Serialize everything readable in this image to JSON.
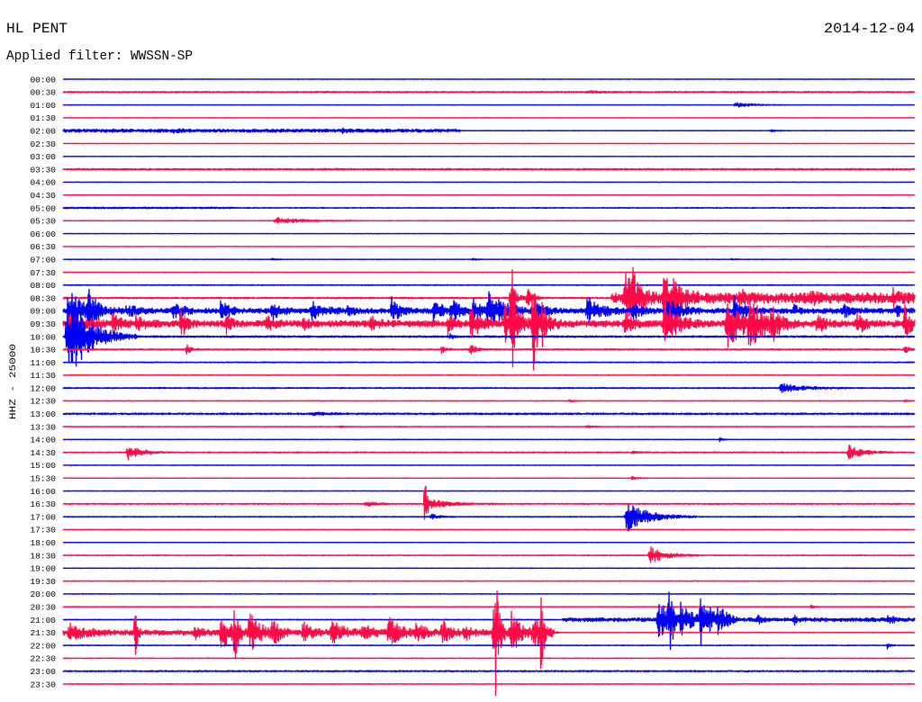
{
  "chart_data": {
    "type": "line",
    "title": "HL PENT",
    "date": "2014-12-04",
    "subtitle": "Applied filter: WWSSN-SP",
    "ylabel": "HHZ - 25000",
    "xlim_minutes": [
      0,
      30
    ],
    "grid": false,
    "colors": {
      "blue": "#0000f2",
      "red": "#ff0a46"
    },
    "rows": [
      {
        "label": "00:00",
        "color": "blue",
        "noise": 400,
        "bursts": []
      },
      {
        "label": "00:30",
        "color": "red",
        "noise": 1200,
        "bursts": [
          {
            "start": 18.4,
            "dur": 1.0,
            "amp": 2500
          }
        ]
      },
      {
        "label": "01:00",
        "color": "blue",
        "noise": 400,
        "bursts": [
          {
            "start": 23.6,
            "dur": 1.2,
            "amp": 6000
          }
        ]
      },
      {
        "label": "01:30",
        "color": "red",
        "noise": 400,
        "bursts": []
      },
      {
        "label": "02:00",
        "color": "blue",
        "noise": [
          {
            "start": 0,
            "end": 14,
            "amp": 3000
          },
          {
            "start": 14,
            "end": 30,
            "amp": 500
          }
        ],
        "bursts": [
          {
            "start": 3.8,
            "dur": 0.6,
            "amp": 4000
          },
          {
            "start": 9.8,
            "dur": 0.6,
            "amp": 4000
          },
          {
            "start": 24.9,
            "dur": 0.5,
            "amp": 2500
          }
        ]
      },
      {
        "label": "02:30",
        "color": "red",
        "noise": 400,
        "bursts": []
      },
      {
        "label": "03:00",
        "color": "blue",
        "noise": 400,
        "bursts": []
      },
      {
        "label": "03:30",
        "color": "red",
        "noise": 1500,
        "bursts": []
      },
      {
        "label": "04:00",
        "color": "blue",
        "noise": 400,
        "bursts": []
      },
      {
        "label": "04:30",
        "color": "red",
        "noise": 400,
        "bursts": []
      },
      {
        "label": "05:00",
        "color": "blue",
        "noise": [
          {
            "start": 0,
            "end": 6,
            "amp": 1500
          },
          {
            "start": 6,
            "end": 30,
            "amp": 800
          }
        ],
        "bursts": []
      },
      {
        "label": "05:30",
        "color": "red",
        "noise": 500,
        "bursts": [
          {
            "start": 7.4,
            "dur": 2.0,
            "amp": 7000
          }
        ]
      },
      {
        "label": "06:00",
        "color": "blue",
        "noise": 400,
        "bursts": []
      },
      {
        "label": "06:30",
        "color": "red",
        "noise": 400,
        "bursts": []
      },
      {
        "label": "07:00",
        "color": "blue",
        "noise": 500,
        "bursts": [
          {
            "start": 7.3,
            "dur": 0.3,
            "amp": 2500
          },
          {
            "start": 14.4,
            "dur": 0.3,
            "amp": 3000
          },
          {
            "start": 23.5,
            "dur": 0.3,
            "amp": 2000
          }
        ]
      },
      {
        "label": "07:30",
        "color": "red",
        "noise": 400,
        "bursts": []
      },
      {
        "label": "08:00",
        "color": "blue",
        "noise": 800,
        "bursts": []
      },
      {
        "label": "08:30",
        "color": "red",
        "noise": [
          {
            "start": 0,
            "end": 19.3,
            "amp": 1500
          },
          {
            "start": 19.3,
            "end": 30,
            "amp": 10000
          }
        ],
        "bursts": [
          {
            "start": 15.7,
            "dur": 0.5,
            "amp": 30000
          },
          {
            "start": 16.3,
            "dur": 0.4,
            "amp": 25000
          },
          {
            "start": 19.7,
            "dur": 0.8,
            "amp": 60000
          },
          {
            "start": 20.0,
            "dur": 0.5,
            "amp": 40000
          },
          {
            "start": 21.1,
            "dur": 0.8,
            "amp": 55000
          },
          {
            "start": 21.4,
            "dur": 0.6,
            "amp": 40000
          },
          {
            "start": 23.8,
            "dur": 0.5,
            "amp": 15000
          },
          {
            "start": 26.3,
            "dur": 0.4,
            "amp": 12000
          },
          {
            "start": 29.2,
            "dur": 0.4,
            "amp": 15000
          }
        ]
      },
      {
        "label": "09:00",
        "color": "blue",
        "noise": 5000,
        "bursts": [
          {
            "start": 0.16,
            "dur": 1.2,
            "amp": 40000
          },
          {
            "start": 0.86,
            "dur": 0.4,
            "amp": 60000
          },
          {
            "start": 2.2,
            "dur": 0.6,
            "amp": 15000
          },
          {
            "start": 3.8,
            "dur": 0.8,
            "amp": 15000
          },
          {
            "start": 5.5,
            "dur": 0.5,
            "amp": 30000
          },
          {
            "start": 7.3,
            "dur": 0.5,
            "amp": 25000
          },
          {
            "start": 8.7,
            "dur": 0.8,
            "amp": 20000
          },
          {
            "start": 10.0,
            "dur": 0.4,
            "amp": 12000
          },
          {
            "start": 11.5,
            "dur": 0.6,
            "amp": 30000
          },
          {
            "start": 13.0,
            "dur": 0.6,
            "amp": 30000
          },
          {
            "start": 13.6,
            "dur": 0.8,
            "amp": 25000
          },
          {
            "start": 14.4,
            "dur": 0.5,
            "amp": 25000
          },
          {
            "start": 14.9,
            "dur": 1.2,
            "amp": 40000
          },
          {
            "start": 16.6,
            "dur": 0.6,
            "amp": 20000
          },
          {
            "start": 18.4,
            "dur": 1.0,
            "amp": 30000
          },
          {
            "start": 20.0,
            "dur": 0.6,
            "amp": 20000
          },
          {
            "start": 21.2,
            "dur": 0.8,
            "amp": 30000
          },
          {
            "start": 23.6,
            "dur": 0.7,
            "amp": 35000
          },
          {
            "start": 25.7,
            "dur": 0.4,
            "amp": 12000
          },
          {
            "start": 27.4,
            "dur": 0.6,
            "amp": 15000
          },
          {
            "start": 29.3,
            "dur": 0.5,
            "amp": 12000
          }
        ]
      },
      {
        "label": "09:30",
        "color": "red",
        "noise": 6000,
        "bursts": [
          {
            "start": 0.16,
            "dur": 1.0,
            "amp": 25000
          },
          {
            "start": 1.7,
            "dur": 0.6,
            "amp": 20000
          },
          {
            "start": 2.5,
            "dur": 0.6,
            "amp": 20000
          },
          {
            "start": 4.1,
            "dur": 0.4,
            "amp": 35000
          },
          {
            "start": 5.7,
            "dur": 0.4,
            "amp": 20000
          },
          {
            "start": 7.1,
            "dur": 0.5,
            "amp": 20000
          },
          {
            "start": 8.4,
            "dur": 0.4,
            "amp": 15000
          },
          {
            "start": 10.8,
            "dur": 0.6,
            "amp": 15000
          },
          {
            "start": 13.5,
            "dur": 0.4,
            "amp": 25000
          },
          {
            "start": 14.3,
            "dur": 0.6,
            "amp": 45000
          },
          {
            "start": 15.5,
            "dur": 1.0,
            "amp": 55000
          },
          {
            "start": 15.8,
            "dur": 0.15,
            "amp": 230000
          },
          {
            "start": 16.5,
            "dur": 0.3,
            "amp": 160000
          },
          {
            "start": 16.8,
            "dur": 0.6,
            "amp": 40000
          },
          {
            "start": 19.7,
            "dur": 0.6,
            "amp": 25000
          },
          {
            "start": 21.1,
            "dur": 1.0,
            "amp": 45000
          },
          {
            "start": 23.3,
            "dur": 1.2,
            "amp": 60000
          },
          {
            "start": 24.1,
            "dur": 1.0,
            "amp": 50000
          },
          {
            "start": 24.9,
            "dur": 0.8,
            "amp": 30000
          },
          {
            "start": 26.5,
            "dur": 0.6,
            "amp": 20000
          },
          {
            "start": 27.9,
            "dur": 0.6,
            "amp": 25000
          },
          {
            "start": 29.6,
            "dur": 0.4,
            "amp": 45000
          }
        ]
      },
      {
        "label": "10:00",
        "color": "blue",
        "noise": 1500,
        "bursts": [
          {
            "start": 0.06,
            "dur": 1.6,
            "amp": 100000
          },
          {
            "start": 13.6,
            "dur": 0.3,
            "amp": 6000
          }
        ]
      },
      {
        "label": "10:30",
        "color": "red",
        "noise": 1200,
        "bursts": [
          {
            "start": 4.3,
            "dur": 0.3,
            "amp": 15000
          },
          {
            "start": 13.3,
            "dur": 0.3,
            "amp": 10000
          },
          {
            "start": 14.3,
            "dur": 0.4,
            "amp": 15000
          },
          {
            "start": 29.6,
            "dur": 0.3,
            "amp": 12000
          }
        ]
      },
      {
        "label": "11:00",
        "color": "blue",
        "noise": 800,
        "bursts": []
      },
      {
        "label": "11:30",
        "color": "red",
        "noise": 600,
        "bursts": []
      },
      {
        "label": "12:00",
        "color": "blue",
        "noise": 1000,
        "bursts": [
          {
            "start": 25.2,
            "dur": 1.6,
            "amp": 10000
          }
        ]
      },
      {
        "label": "12:30",
        "color": "red",
        "noise": 600,
        "bursts": [
          {
            "start": 17.8,
            "dur": 0.3,
            "amp": 3000
          },
          {
            "start": 29.6,
            "dur": 0.3,
            "amp": 3000
          }
        ]
      },
      {
        "label": "13:00",
        "color": "blue",
        "noise": 1500,
        "bursts": [
          {
            "start": 8.7,
            "dur": 1.2,
            "amp": 3000
          }
        ]
      },
      {
        "label": "13:30",
        "color": "red",
        "noise": 600,
        "bursts": [
          {
            "start": 9.7,
            "dur": 0.3,
            "amp": 3000
          },
          {
            "start": 18.4,
            "dur": 0.4,
            "amp": 3000
          }
        ]
      },
      {
        "label": "14:00",
        "color": "blue",
        "noise": 500,
        "bursts": [
          {
            "start": 23.1,
            "dur": 0.2,
            "amp": 6000
          }
        ]
      },
      {
        "label": "14:30",
        "color": "red",
        "noise": 1000,
        "bursts": [
          {
            "start": 2.2,
            "dur": 1.0,
            "amp": 16000
          },
          {
            "start": 20.0,
            "dur": 0.4,
            "amp": 3000
          },
          {
            "start": 27.6,
            "dur": 1.0,
            "amp": 16000
          }
        ]
      },
      {
        "label": "15:00",
        "color": "blue",
        "noise": 500,
        "bursts": []
      },
      {
        "label": "15:30",
        "color": "red",
        "noise": 400,
        "bursts": [
          {
            "start": 20.0,
            "dur": 0.4,
            "amp": 5000
          }
        ]
      },
      {
        "label": "16:00",
        "color": "blue",
        "noise": 500,
        "bursts": []
      },
      {
        "label": "16:30",
        "color": "red",
        "noise": 1000,
        "bursts": [
          {
            "start": 10.6,
            "dur": 0.7,
            "amp": 7000
          },
          {
            "start": 12.7,
            "dur": 0.25,
            "amp": 70000
          },
          {
            "start": 12.9,
            "dur": 1.5,
            "amp": 9000
          }
        ]
      },
      {
        "label": "17:00",
        "color": "blue",
        "noise": 700,
        "bursts": [
          {
            "start": 12.9,
            "dur": 0.6,
            "amp": 7000
          },
          {
            "start": 19.75,
            "dur": 1.6,
            "amp": 35000
          }
        ]
      },
      {
        "label": "17:30",
        "color": "red",
        "noise": 500,
        "bursts": []
      },
      {
        "label": "18:00",
        "color": "blue",
        "noise": 400,
        "bursts": []
      },
      {
        "label": "18:30",
        "color": "red",
        "noise": 700,
        "bursts": [
          {
            "start": 20.6,
            "dur": 1.2,
            "amp": 20000
          }
        ]
      },
      {
        "label": "19:00",
        "color": "blue",
        "noise": 500,
        "bursts": []
      },
      {
        "label": "19:30",
        "color": "red",
        "noise": 600,
        "bursts": []
      },
      {
        "label": "20:00",
        "color": "blue",
        "noise": 500,
        "bursts": []
      },
      {
        "label": "20:30",
        "color": "red",
        "noise": 600,
        "bursts": [
          {
            "start": 26.3,
            "dur": 0.3,
            "amp": 5000
          }
        ]
      },
      {
        "label": "21:00",
        "color": "blue",
        "noise": [
          {
            "start": 0,
            "end": 17.6,
            "amp": 700
          },
          {
            "start": 17.6,
            "end": 30,
            "amp": 3500
          }
        ],
        "bursts": [
          {
            "start": 20.9,
            "dur": 1.0,
            "amp": 45000
          },
          {
            "start": 21.3,
            "dur": 0.3,
            "amp": 90000
          },
          {
            "start": 21.7,
            "dur": 0.8,
            "amp": 35000
          },
          {
            "start": 22.4,
            "dur": 0.8,
            "amp": 60000
          },
          {
            "start": 23.0,
            "dur": 0.6,
            "amp": 30000
          },
          {
            "start": 24.4,
            "dur": 0.3,
            "amp": 15000
          },
          {
            "start": 25.7,
            "dur": 0.3,
            "amp": 12000
          },
          {
            "start": 29.0,
            "dur": 0.4,
            "amp": 12000
          }
        ]
      },
      {
        "label": "21:30",
        "color": "red",
        "noise": [
          {
            "start": 0,
            "end": 17.3,
            "amp": 5000
          },
          {
            "start": 17.3,
            "end": 30,
            "amp": 500
          }
        ],
        "bursts": [
          {
            "start": 0.16,
            "dur": 1.0,
            "amp": 20000
          },
          {
            "start": 2.5,
            "dur": 0.15,
            "amp": 130000
          },
          {
            "start": 4.6,
            "dur": 0.5,
            "amp": 15000
          },
          {
            "start": 5.5,
            "dur": 1.0,
            "amp": 35000
          },
          {
            "start": 6.0,
            "dur": 0.2,
            "amp": 90000
          },
          {
            "start": 6.5,
            "dur": 0.8,
            "amp": 40000
          },
          {
            "start": 7.3,
            "dur": 0.6,
            "amp": 30000
          },
          {
            "start": 8.4,
            "dur": 0.6,
            "amp": 25000
          },
          {
            "start": 9.4,
            "dur": 0.8,
            "amp": 30000
          },
          {
            "start": 10.5,
            "dur": 0.6,
            "amp": 25000
          },
          {
            "start": 11.4,
            "dur": 0.8,
            "amp": 35000
          },
          {
            "start": 12.4,
            "dur": 0.6,
            "amp": 25000
          },
          {
            "start": 13.3,
            "dur": 0.6,
            "amp": 30000
          },
          {
            "start": 14.1,
            "dur": 0.5,
            "amp": 20000
          },
          {
            "start": 15.1,
            "dur": 0.6,
            "amp": 55000
          },
          {
            "start": 15.2,
            "dur": 0.2,
            "amp": 130000
          },
          {
            "start": 15.7,
            "dur": 0.8,
            "amp": 45000
          },
          {
            "start": 16.5,
            "dur": 0.6,
            "amp": 40000
          },
          {
            "start": 16.8,
            "dur": 0.2,
            "amp": 90000
          }
        ]
      },
      {
        "label": "22:00",
        "color": "blue",
        "noise": 700,
        "bursts": [
          {
            "start": 29.0,
            "dur": 0.2,
            "amp": 10000
          }
        ]
      },
      {
        "label": "22:30",
        "color": "red",
        "noise": 600,
        "bursts": []
      },
      {
        "label": "23:00",
        "color": "blue",
        "noise": 1200,
        "bursts": []
      },
      {
        "label": "23:30",
        "color": "red",
        "noise": 600,
        "bursts": []
      }
    ]
  }
}
